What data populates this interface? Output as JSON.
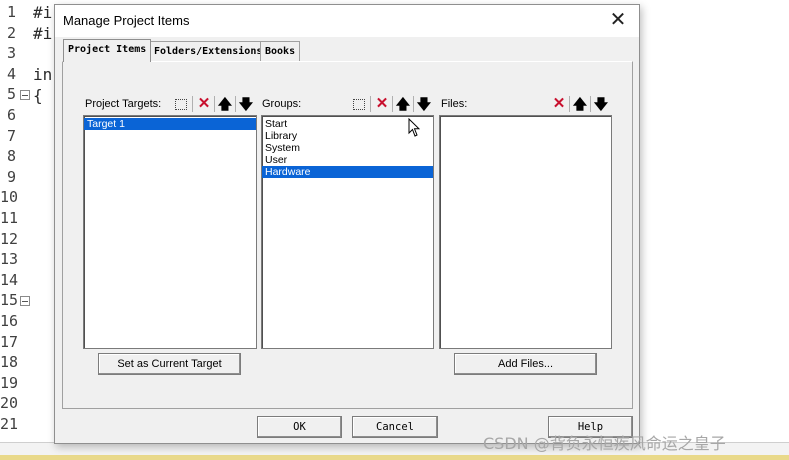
{
  "editor": {
    "line_numbers": [
      "1",
      "2",
      "3",
      "4",
      "5",
      "6",
      "7",
      "8",
      "9",
      "10",
      "11",
      "12",
      "13",
      "14",
      "15",
      "16",
      "17",
      "18",
      "19",
      "20",
      "21"
    ],
    "code_lines": [
      {
        "line": 1,
        "text": "#i"
      },
      {
        "line": 2,
        "text": "#i"
      },
      {
        "line": 4,
        "text": "in"
      },
      {
        "line": 5,
        "text": "{"
      }
    ]
  },
  "dialog": {
    "title": "Manage Project Items",
    "close_label": "✕",
    "tabs": [
      {
        "label": "Project Items",
        "active": true
      },
      {
        "label": "Folders/Extensions",
        "active": false
      },
      {
        "label": "Books",
        "active": false
      }
    ],
    "targets": {
      "label": "Project Targets:",
      "items": [
        "Target 1"
      ],
      "selected": "Target 1"
    },
    "groups": {
      "label": "Groups:",
      "items": [
        "Start",
        "Library",
        "System",
        "User",
        "Hardware"
      ],
      "selected": "Hardware"
    },
    "files": {
      "label": "Files:",
      "items": []
    },
    "buttons": {
      "set_current": "Set as Current Target",
      "add_files": "Add Files...",
      "ok": "OK",
      "cancel": "Cancel",
      "help": "Help"
    },
    "toolbar_icons": {
      "new": "new-item-icon",
      "delete": "delete-icon",
      "up": "move-up-icon",
      "down": "move-down-icon"
    }
  },
  "watermark": "CSDN @背负永恒疾风命运之皇子",
  "colors": {
    "selection": "#0a64d6",
    "delete_icon": "#c8102e",
    "dialog_bg": "#f0f0f0"
  }
}
